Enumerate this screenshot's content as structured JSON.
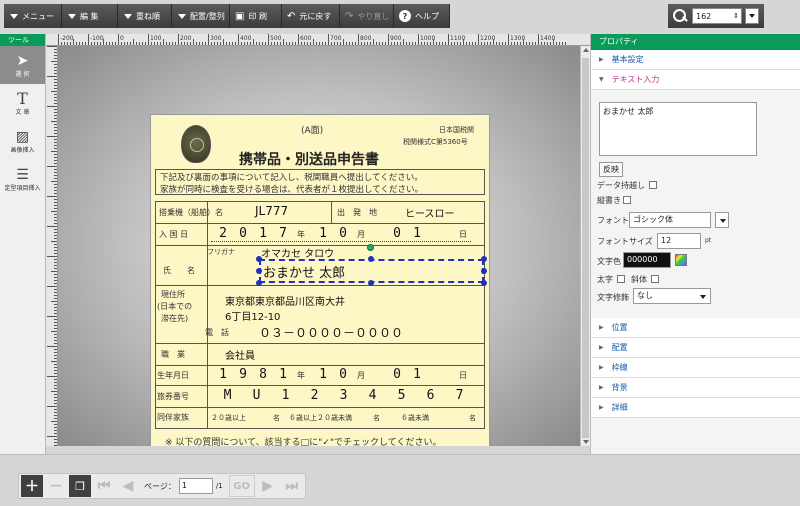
{
  "toolbar": {
    "menu": "メニュー",
    "edit": "編 集",
    "stack": "重ね順",
    "arrange": "配置/整列",
    "print": "印 刷",
    "undo": "元に戻す",
    "redo": "やり直し",
    "help": "ヘルプ",
    "zoom_value": "162"
  },
  "tools": {
    "header": "ツール",
    "items": [
      {
        "label": "選 択",
        "icon": "arrow-select-icon"
      },
      {
        "label": "文 章",
        "icon": "text-icon"
      },
      {
        "label": "画像挿入",
        "icon": "image-icon"
      },
      {
        "label": "定型項目挿入",
        "icon": "list-icon"
      }
    ]
  },
  "ruler": {
    "labels": [
      "-200",
      "-100",
      "0",
      "100",
      "200",
      "300",
      "400",
      "500",
      "600",
      "700",
      "800",
      "900",
      "1000",
      "1100",
      "1200",
      "1300",
      "1400"
    ]
  },
  "form": {
    "side": "(A面)",
    "agency1": "日本国税関",
    "agency2": "税関様式C第5360号",
    "title": "携帯品・別送品申告書",
    "notice1": "下記及び裏面の事項について記入し、税関職員へ提出してください。",
    "notice2": "家族が同時に検査を受ける場合は、代表者が１枚提出してください。",
    "flight_label": "搭乗機（船舶）名",
    "flight_value": "JL777",
    "departure_label": "出　発　地",
    "departure_value": "ヒースロー",
    "entry_label": "入 国 日",
    "entry_digits": [
      "2",
      "0",
      "1",
      "7"
    ],
    "entry_month": [
      "1",
      "0"
    ],
    "entry_day": [
      "0",
      "1"
    ],
    "year_unit": "年",
    "month_unit": "月",
    "day_unit": "日",
    "furigana_label": "フリガナ",
    "furigana_value": "オマカセ タロウ",
    "name_label": "氏　　名",
    "name_value": "おまかせ 太郎",
    "address_label1": "現住所",
    "address_label2": "(日本での",
    "address_label3": "滞在先)",
    "address_value1": "東京都東京都品川区南大井",
    "address_value2": "6丁目12-10",
    "phone_label": "電　話",
    "phone_value": "０３－００００－００００",
    "job_label": "職　業",
    "job_value": "会社員",
    "birth_label": "生年月日",
    "birth_digits": [
      "1",
      "9",
      "8",
      "1"
    ],
    "birth_month": [
      "1",
      "0"
    ],
    "birth_day": [
      "0",
      "1"
    ],
    "passport_label": "旅券番号",
    "passport_value": [
      "M",
      "U",
      "1",
      "2",
      "3",
      "4",
      "5",
      "6",
      "7"
    ],
    "family_label": "同伴家族",
    "family_adult": "２０歳以上",
    "family_teen": "６歳以上２０歳未満",
    "family_child": "６歳未満",
    "family_unit": "名",
    "footer": "※ 以下の質問について、該当する□に\"✓\"でチェックしてください。"
  },
  "props": {
    "header": "プロパティ",
    "basic": "基本設定",
    "text_input": "テキスト入力",
    "text_value": "おまかせ 太郎",
    "reflect_button": "反映",
    "data_keep": "データ持越し",
    "vertical": "縦書き",
    "font_label": "フォント",
    "font_value": "ゴシック体",
    "size_label": "フォントサイズ",
    "size_value": "12",
    "size_unit": "pt",
    "color_label": "文字色",
    "color_value": "000000",
    "bold": "太字",
    "italic": "斜体",
    "decoration_label": "文字修飾",
    "decoration_value": "なし",
    "sections": [
      "位置",
      "配置",
      "枠線",
      "背景",
      "詳細"
    ]
  },
  "pager": {
    "page_label": "ページ：",
    "page_value": "1",
    "page_total": "/1",
    "go": "GO"
  },
  "colors": {
    "accent": "#0a9a5a",
    "selection": "#2030c0",
    "paper": "#fdf6c5"
  }
}
